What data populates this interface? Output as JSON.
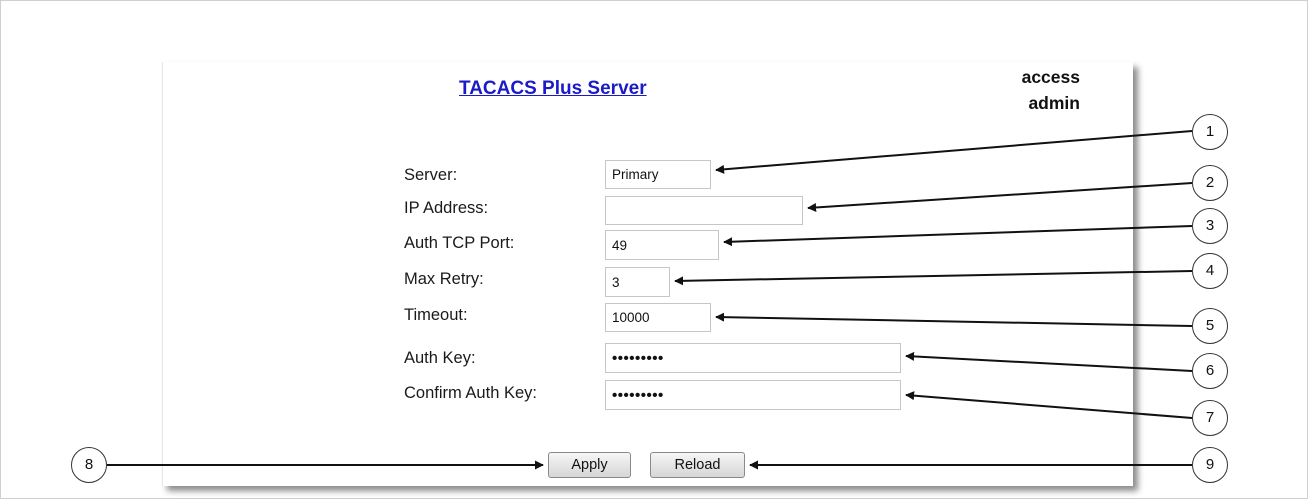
{
  "header": {
    "title": "TACACS Plus Server",
    "access_label": "access",
    "user_label": "admin"
  },
  "form": {
    "server": {
      "label": "Server:",
      "value": "Primary"
    },
    "ip_address": {
      "label": "IP Address:",
      "value": ""
    },
    "auth_tcp_port": {
      "label": "Auth TCP Port:",
      "value": "49"
    },
    "max_retry": {
      "label": "Max Retry:",
      "value": "3"
    },
    "timeout": {
      "label": "Timeout:",
      "value": "10000"
    },
    "auth_key": {
      "label": "Auth Key:",
      "value": "•••••••••"
    },
    "confirm_auth_key": {
      "label": "Confirm Auth Key:",
      "value": "•••••••••"
    }
  },
  "buttons": {
    "apply_label": "Apply",
    "reload_label": "Reload"
  },
  "callouts": [
    "1",
    "2",
    "3",
    "4",
    "5",
    "6",
    "7",
    "8",
    "9"
  ],
  "colors": {
    "title_link": "#1a1ac8",
    "border": "#c6c6c6",
    "callout_line": "#111111"
  }
}
